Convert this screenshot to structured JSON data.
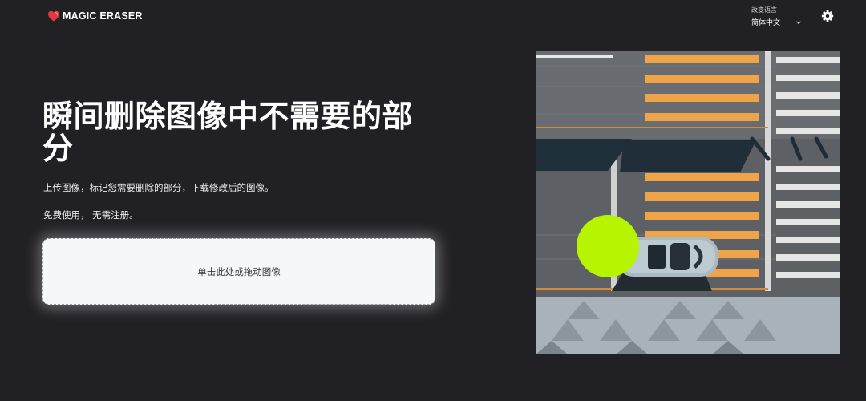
{
  "header": {
    "brand": "MAGIC ERASER",
    "language_caption": "改变语言",
    "language_value": "简体中文"
  },
  "hero": {
    "headline": "瞬间删除图像中不需要的部分",
    "description": "上传图像，标记您需要删除的部分，下载修改后的图像。",
    "note": "免费使用， 无需注册。"
  },
  "upload": {
    "label": "单击此处或拖动图像"
  },
  "icons": {
    "logo": "heart-logo-icon",
    "settings": "gear-icon",
    "language_dropdown": "chevron-down-icon"
  },
  "colors": {
    "background": "#212025",
    "brand_red": "#e2383f",
    "marker": "#b6f400",
    "dropzone": "#f6f7fa"
  }
}
